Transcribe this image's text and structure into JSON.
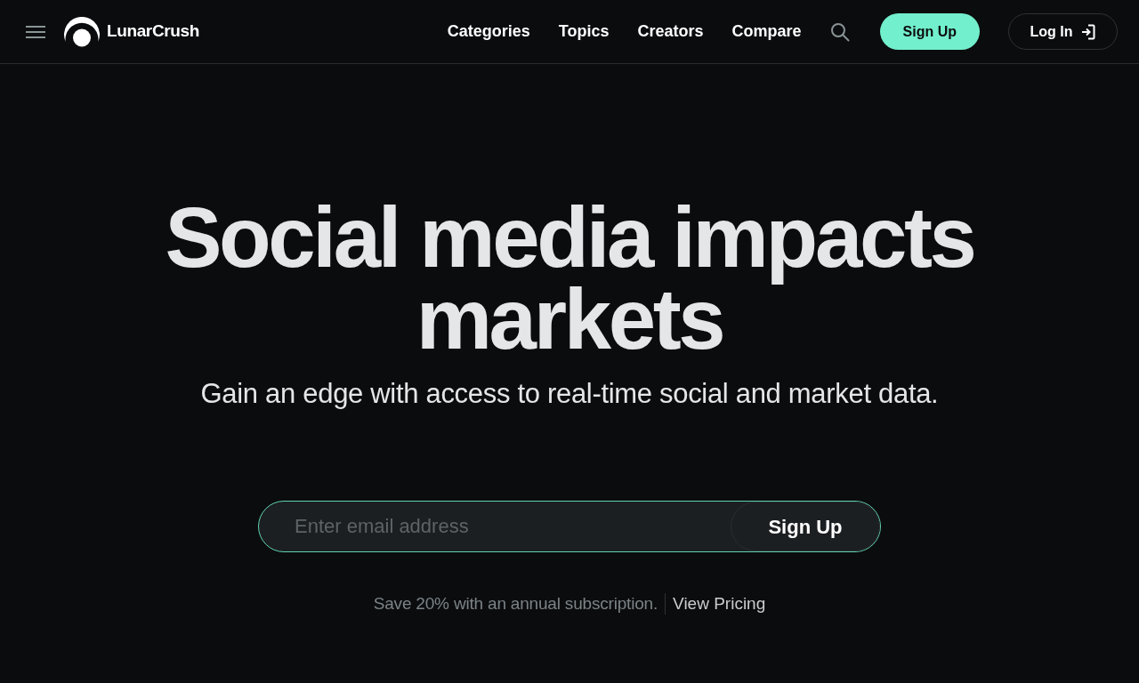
{
  "header": {
    "brand": "LunarCrush",
    "nav": [
      "Categories",
      "Topics",
      "Creators",
      "Compare"
    ],
    "sign_up": "Sign Up",
    "log_in": "Log In"
  },
  "hero": {
    "title": "Social media impacts markets",
    "subtitle": "Gain an edge with access to real-time social and market data.",
    "email_field": {
      "placeholder": "Enter email address"
    },
    "submit": "Sign Up",
    "note": "Save 20% with an annual subscription.",
    "link": "View Pricing"
  }
}
